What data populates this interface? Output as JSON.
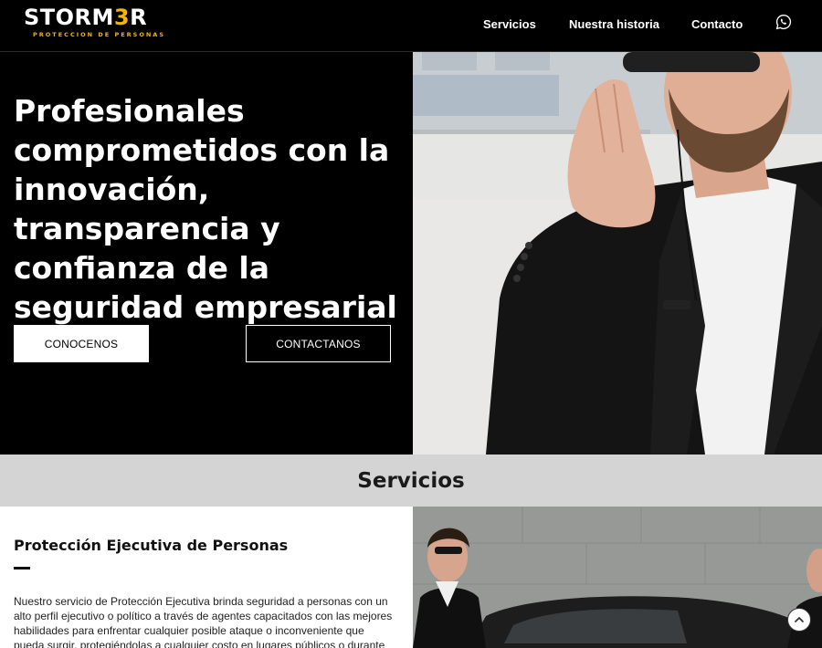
{
  "brand": {
    "logo_part1": "STORM",
    "logo_part2": "3",
    "logo_part3": "R",
    "tagline": "PROTECCION DE PERSONAS",
    "accent_color": "#f4b400"
  },
  "nav": {
    "items": [
      {
        "label": "Servicios"
      },
      {
        "label": "Nuestra historia"
      },
      {
        "label": "Contacto"
      }
    ],
    "whatsapp_icon": "whatsapp-icon"
  },
  "hero": {
    "title": "Profesionales comprometidos con la innovación, transparencia y confianza de la seguridad empresarial",
    "primary_button": "CONOCENOS",
    "secondary_button": "CONTACTANOS"
  },
  "services": {
    "section_title": "Servicios",
    "items": [
      {
        "title": "Protección Ejecutiva de Personas",
        "description": "Nuestro servicio de Protección Ejecutiva brinda seguridad a personas con un alto perfil ejecutivo o político a través de agentes capacitados con las mejores habilidades para enfrentar cualquier posible ataque o inconveniente que pueda surgir, protegiéndolas a cualquier costo en lugares públicos o durante los"
      }
    ]
  },
  "scroll_top_icon": "chevron-up-icon"
}
